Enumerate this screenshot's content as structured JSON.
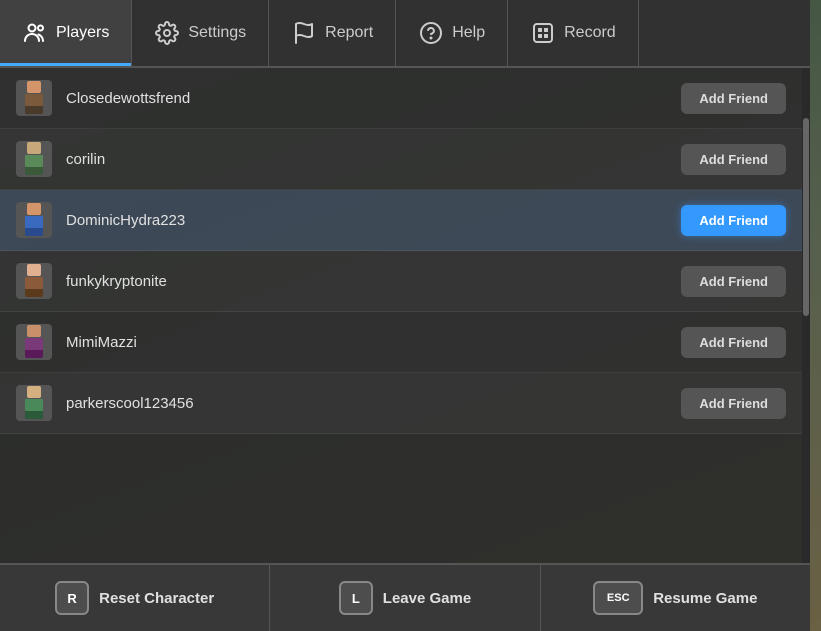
{
  "tabs": [
    {
      "id": "players",
      "label": "Players",
      "icon": "users",
      "active": true
    },
    {
      "id": "settings",
      "label": "Settings",
      "icon": "gear",
      "active": false
    },
    {
      "id": "report",
      "label": "Report",
      "icon": "flag",
      "active": false
    },
    {
      "id": "help",
      "label": "Help",
      "icon": "circle-question",
      "active": false
    },
    {
      "id": "record",
      "label": "Record",
      "icon": "record",
      "active": false
    }
  ],
  "players": [
    {
      "id": 1,
      "name": "Closedewottsfrend",
      "add_friend_label": "Add Friend",
      "selected": false,
      "highlighted": false
    },
    {
      "id": 2,
      "name": "corilin",
      "add_friend_label": "Add Friend",
      "selected": false,
      "highlighted": false
    },
    {
      "id": 3,
      "name": "DominicHydra223",
      "add_friend_label": "Add Friend",
      "selected": true,
      "highlighted": true
    },
    {
      "id": 4,
      "name": "funkykryptonite",
      "add_friend_label": "Add Friend",
      "selected": false,
      "highlighted": false
    },
    {
      "id": 5,
      "name": "MimiMazzi",
      "add_friend_label": "Add Friend",
      "selected": false,
      "highlighted": false
    },
    {
      "id": 6,
      "name": "parkerscool123456",
      "add_friend_label": "Add Friend",
      "selected": false,
      "highlighted": false
    }
  ],
  "actions": [
    {
      "id": "reset",
      "key": "R",
      "label": "Reset Character"
    },
    {
      "id": "leave",
      "key": "L",
      "label": "Leave Game"
    },
    {
      "id": "resume",
      "key": "ESC",
      "label": "Resume Game"
    }
  ]
}
